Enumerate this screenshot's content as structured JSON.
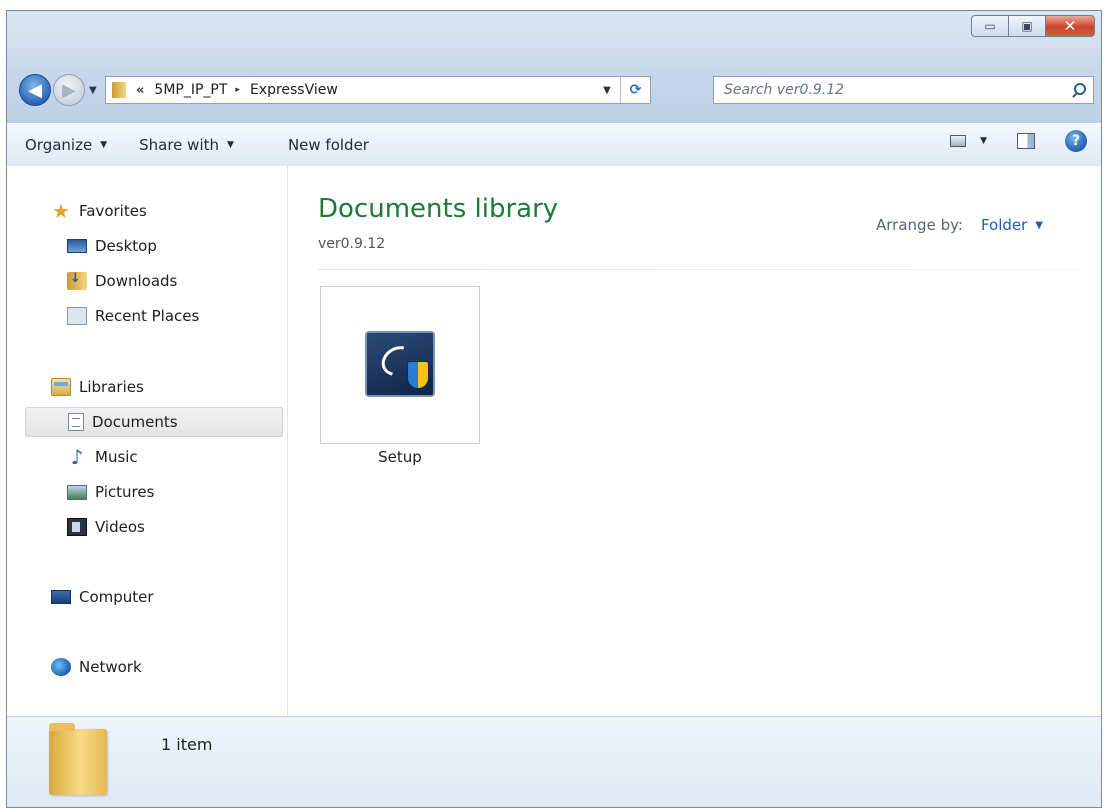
{
  "window": {
    "caption_buttons": {
      "minimize": "▭",
      "maximize": "▣",
      "close": "✕"
    }
  },
  "nav": {
    "back_glyph": "◀",
    "forward_glyph": "▶",
    "address": {
      "overflow_chevron": "«",
      "breadcrumbs": [
        "5MP_IP_PT",
        "ExpressView"
      ],
      "separator": "▸"
    },
    "search": {
      "placeholder": "Search ver0.9.12"
    }
  },
  "toolbar": {
    "organize_label": "Organize",
    "share_label": "Share with",
    "new_folder_label": "New folder",
    "dropdown_arrow": "▼",
    "help_glyph": "?"
  },
  "sidebar": {
    "favorites": {
      "label": "Favorites",
      "items": [
        {
          "label": "Desktop",
          "icon": "desktop-icon"
        },
        {
          "label": "Downloads",
          "icon": "downloads-icon"
        },
        {
          "label": "Recent Places",
          "icon": "recent-places-icon"
        }
      ]
    },
    "libraries": {
      "label": "Libraries",
      "items": [
        {
          "label": "Documents",
          "icon": "documents-icon",
          "selected": true
        },
        {
          "label": "Music",
          "icon": "music-icon"
        },
        {
          "label": "Pictures",
          "icon": "pictures-icon"
        },
        {
          "label": "Videos",
          "icon": "videos-icon"
        }
      ]
    },
    "computer": {
      "label": "Computer"
    },
    "network": {
      "label": "Network"
    }
  },
  "main": {
    "title": "Documents library",
    "subtitle": "ver0.9.12",
    "arrange_label": "Arrange by:",
    "arrange_value": "Folder",
    "files": [
      {
        "name": "Setup",
        "icon": "setup-installer-icon"
      }
    ]
  },
  "details": {
    "count_text": "1 item"
  },
  "colors": {
    "library_title": "#1e7a3a",
    "link_blue": "#1f5fae",
    "close_button": "#c8452b"
  }
}
